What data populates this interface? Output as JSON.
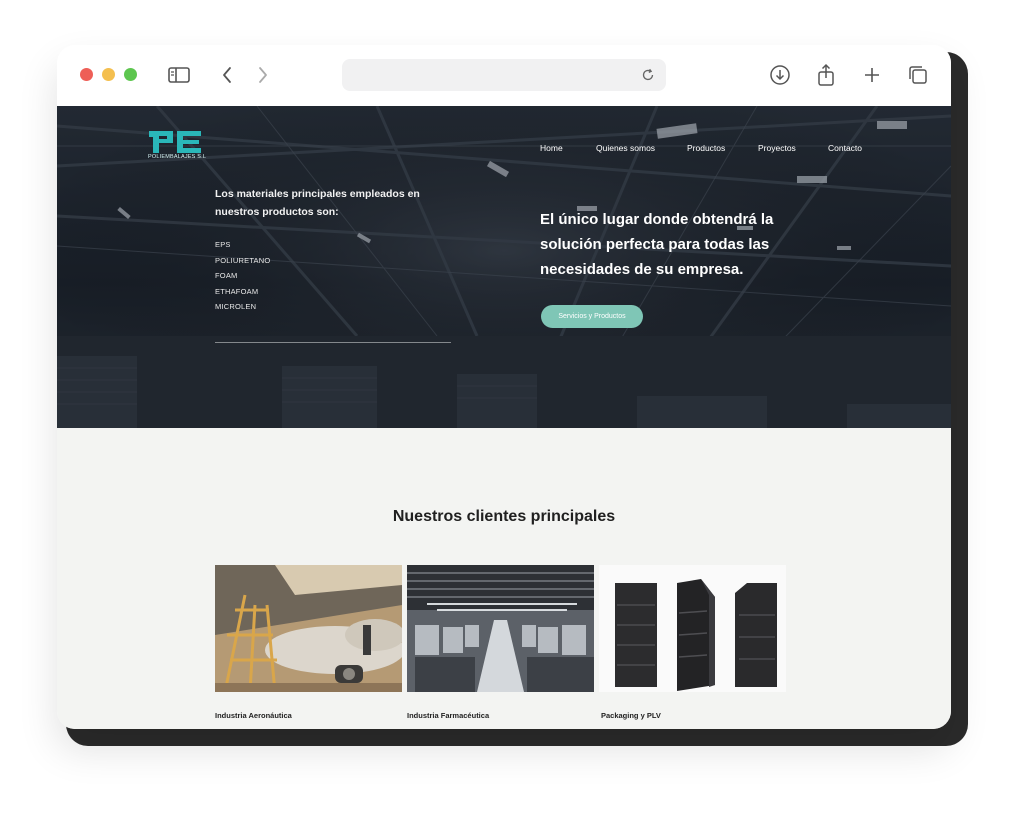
{
  "browser": {
    "address_text": "",
    "icons": [
      "sidebar-icon",
      "back-icon",
      "forward-icon",
      "reload-icon",
      "download-icon",
      "share-icon",
      "new-tab-icon",
      "tabs-icon"
    ]
  },
  "site": {
    "logo_text": "POLIEMBALAJES S.L",
    "nav": [
      "Home",
      "Quienes somos",
      "Productos",
      "Proyectos",
      "Contacto"
    ],
    "materials_title": "Los materiales principales empleados en nuestros productos son:",
    "materials": [
      "EPS",
      "POLIURETANO",
      "FOAM",
      "ETHAFOAM",
      "MICROLEN"
    ],
    "tagline": "El único lugar donde obtendrá la solución perfecta para todas las necesidades de su empresa.",
    "cta_label": "Servicios y Productos"
  },
  "clients": {
    "title": "Nuestros clientes principales",
    "items": [
      {
        "label": "Industria Aeronáutica"
      },
      {
        "label": "Industria Farmacéutica"
      },
      {
        "label": "Packaging y PLV"
      }
    ]
  },
  "colors": {
    "accent": "#2ab7b9",
    "button": "#7fc6b6",
    "section_bg": "#f3f4f2",
    "hero_bg": "#1f2630"
  }
}
